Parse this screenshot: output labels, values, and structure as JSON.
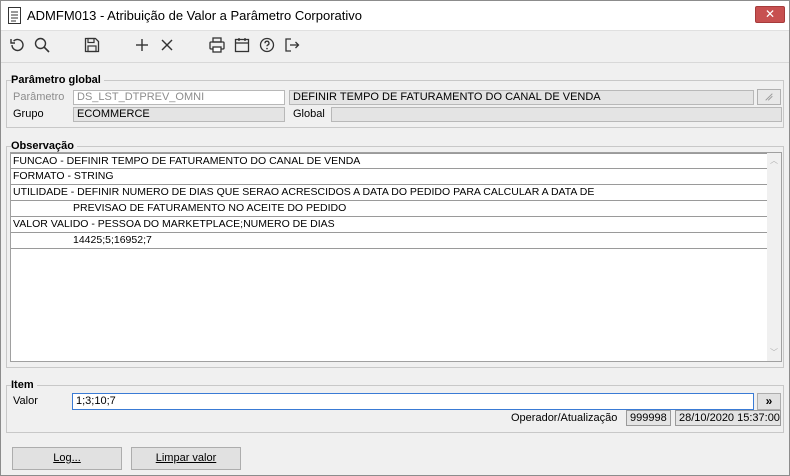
{
  "window": {
    "title": "ADMFM013 - Atribuição de Valor a Parâmetro Corporativo",
    "close_label": "✕"
  },
  "toolbar": {
    "icons": [
      "undo-icon",
      "search-icon",
      "save-icon",
      "add-icon",
      "delete-icon",
      "print-icon",
      "calendar-icon",
      "help-icon",
      "exit-icon"
    ]
  },
  "parametro_global": {
    "title": "Parâmetro global",
    "parametro_label": "Parâmetro",
    "parametro_value": "DS_LST_DTPREV_OMNI",
    "parametro_desc": "DEFINIR TEMPO DE FATURAMENTO DO CANAL DE VENDA",
    "grupo_label": "Grupo",
    "grupo_value": "ECOMMERCE",
    "global_label": "Global",
    "global_value": ""
  },
  "observacao": {
    "title": "Observação",
    "lines": [
      "FUNCAO - DEFINIR TEMPO DE FATURAMENTO DO CANAL DE VENDA",
      "FORMATO - STRING",
      "UTILIDADE - DEFINIR NUMERO DE DIAS QUE SERAO ACRESCIDOS A DATA DO PEDIDO PARA CALCULAR A DATA DE",
      "PREVISAO DE FATURAMENTO NO ACEITE DO PEDIDO",
      "VALOR VALIDO - PESSOA DO MARKETPLACE;NUMERO DE DIAS",
      "14425;5;16952;7"
    ]
  },
  "item": {
    "title": "Item",
    "valor_label": "Valor",
    "valor_value": "1;3;10;7",
    "more_button": "»",
    "operador_label": "Operador/Atualização",
    "operador_value": "999998",
    "atualizacao_value": "28/10/2020 15:37:00"
  },
  "buttons": {
    "log": "Log...",
    "limpar": "Limpar valor"
  },
  "colors": {
    "close_bg": "#c75050",
    "focus_border": "#3a7bd5"
  }
}
